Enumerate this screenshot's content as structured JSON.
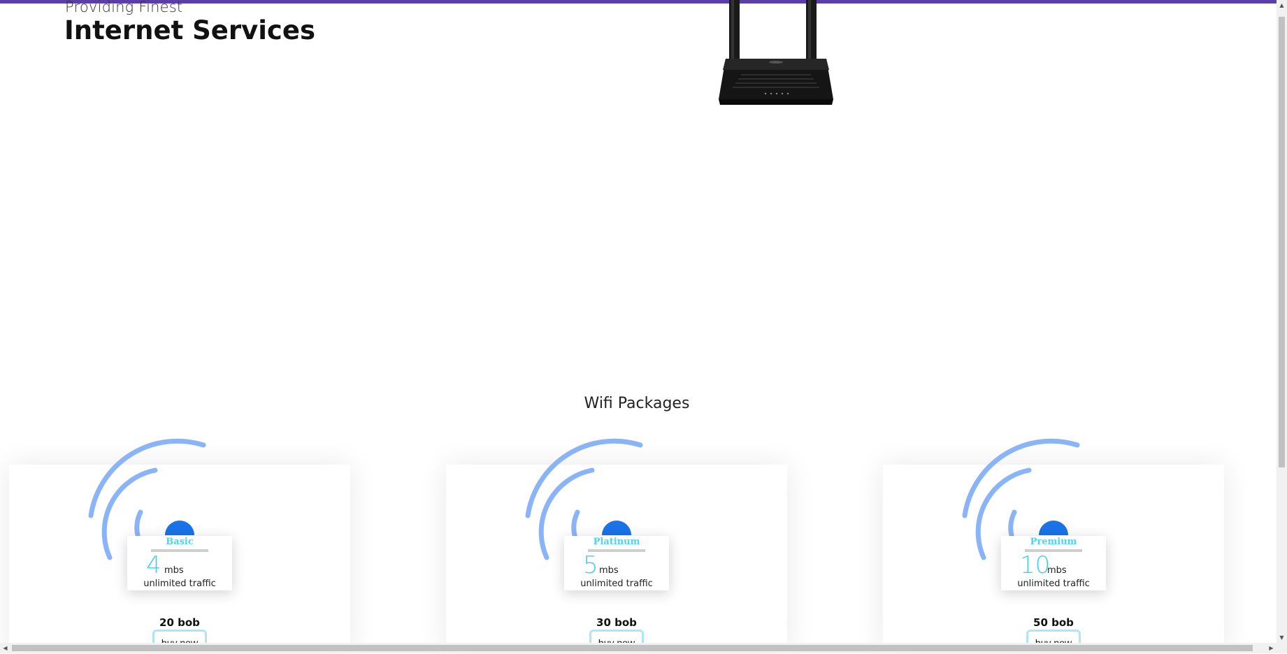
{
  "hero": {
    "subtitle": "Providing Finest",
    "title": "Internet Services"
  },
  "section": {
    "title": "Wifi Packages"
  },
  "packages": [
    {
      "name": "Basic",
      "speed": "4",
      "unit": "mbs",
      "traffic": "unlimited traffic",
      "price": "20 bob",
      "button": "buy now"
    },
    {
      "name": "Platinum",
      "speed": "5",
      "unit": "mbs",
      "traffic": "unlimited traffic",
      "price": "30 bob",
      "button": "buy now"
    },
    {
      "name": "Premium",
      "speed": "10",
      "unit": "mbs",
      "traffic": "unlimited traffic",
      "price": "50 bob",
      "button": "buy now"
    }
  ],
  "colors": {
    "accent_bar": "#5b3fa8",
    "wifi_dot": "#1a73e8",
    "wifi_arcs": "#8ab4f8",
    "plan_name": "#4fd3ee",
    "speed": "#44cfe9",
    "button_border": "#aee6f3"
  },
  "icons": {
    "router": "router-image",
    "wifi": "wifi-icon"
  }
}
